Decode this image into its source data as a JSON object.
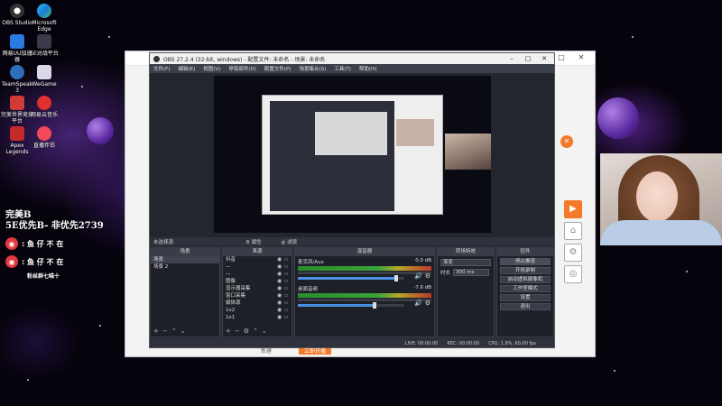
{
  "colors": {
    "accent_orange": "#f4792b",
    "obs_dark": "#2b2e38",
    "meter_green": "#3aa33a",
    "weibo_red": "#e0383e",
    "fader_blue": "#4a90e2"
  },
  "desktop": {
    "icons": [
      {
        "label": "OBS Studio",
        "icon": "obs-icon"
      },
      {
        "label": "Microsoft Edge",
        "icon": "edge-icon"
      },
      {
        "label": "网易UU加速器",
        "icon": "uu-icon"
      },
      {
        "label": "5E对战平台",
        "icon": "5e-icon"
      },
      {
        "label": "TeamSpeak 3",
        "icon": "teamspeak-icon"
      },
      {
        "label": "WeGame",
        "icon": "wegame-icon"
      },
      {
        "label": "完美世界竞技平台",
        "icon": "perfectworld-icon"
      },
      {
        "label": "网易云音乐",
        "icon": "neteasemusic-icon"
      },
      {
        "label": "Apex Legends",
        "icon": "apex-icon"
      },
      {
        "label": "直播伴侣",
        "icon": "livecompanion-icon"
      }
    ]
  },
  "overlay": {
    "line1": "完美B",
    "line2": "5E优先B- 非优先2739",
    "social1": ": 鱼 仔 不 在",
    "social2": ": 鱼 仔 不 在",
    "fan_group": "粉丝群七喵十"
  },
  "obs": {
    "window_title": "OBS 27.2.4 (32-bit, windows) - 配置文件: 未命名 - 场景: 未命名",
    "window_controls": [
      "–",
      "□",
      "✕"
    ],
    "menu": [
      "文件(F)",
      "编辑(E)",
      "视图(V)",
      "停靠部件(D)",
      "配置文件(P)",
      "场景集合(S)",
      "工具(T)",
      "帮助(H)"
    ],
    "scene_label": "未选择源",
    "properties_label": "属性",
    "filters_label": "滤镜",
    "docks": {
      "scenes": {
        "title": "场景",
        "items": [
          "场景",
          "场景 2"
        ]
      },
      "sources": {
        "title": "来源",
        "items": [
          "抖音",
          "—",
          "—",
          "图像",
          "显示器采集",
          "窗口采集",
          "媒体源",
          "1x2",
          "1x1"
        ]
      },
      "mixer": {
        "title": "混音器",
        "channels": [
          {
            "name": "麦克风/Aux",
            "db": "0.0 dB",
            "volume": 0.92
          },
          {
            "name": "桌面音频",
            "db": "-7.6 dB",
            "volume": 0.72
          }
        ]
      },
      "transitions": {
        "title": "转场特效",
        "mode": "渐变",
        "duration_label": "时长",
        "duration_value": "300 ms"
      },
      "controls": {
        "title": "控件",
        "buttons": [
          "停止推流",
          "开始录制",
          "启动虚拟摄像机",
          "工作室模式",
          "设置",
          "退出"
        ]
      }
    },
    "status": {
      "live": "LIVE: 00:00:00",
      "rec": "REC: 00:00:00",
      "cpu": "CPU: 1.9%, 60.00 fps"
    }
  },
  "bgapp": {
    "window_controls": [
      "–",
      "□",
      "✕"
    ],
    "bottom_label1": "新建",
    "bottom_label2": "立即开播"
  }
}
